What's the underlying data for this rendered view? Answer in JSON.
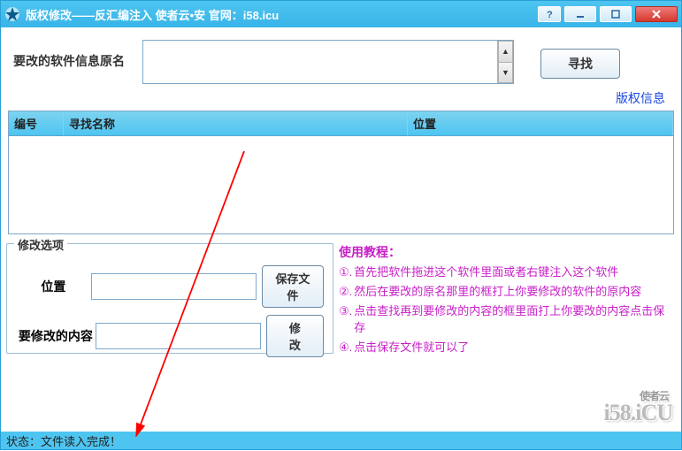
{
  "title": "版权修改——反汇编注入    使者云•安 官网：i58.icu",
  "top": {
    "label": "要改的软件信息原名",
    "value": "",
    "search_btn": "寻找"
  },
  "copyright_link": "版权信息",
  "grid": {
    "col_number": "编号",
    "col_name": "寻找名称",
    "col_pos": "位置"
  },
  "edit": {
    "legend": "修改选项",
    "pos_label": "位置",
    "pos_value": "",
    "save_btn": "保存文件",
    "content_label": "要修改的内容",
    "content_value": "",
    "modify_btn": "修改"
  },
  "tutorial": {
    "title": "使用教程：",
    "step1": "首先把软件拖进这个软件里面或者右键注入这个软件",
    "step2": "然后在要改的原名那里的框打上你要修改的软件的原内容",
    "step3": "点击查找再到要修改的内容的框里面打上你要改的内容点击保存",
    "step4": "点击保存文件就可以了"
  },
  "status": "状态：文件读入完成！",
  "watermark_small": "使者云",
  "watermark_big": "i58.iCU"
}
